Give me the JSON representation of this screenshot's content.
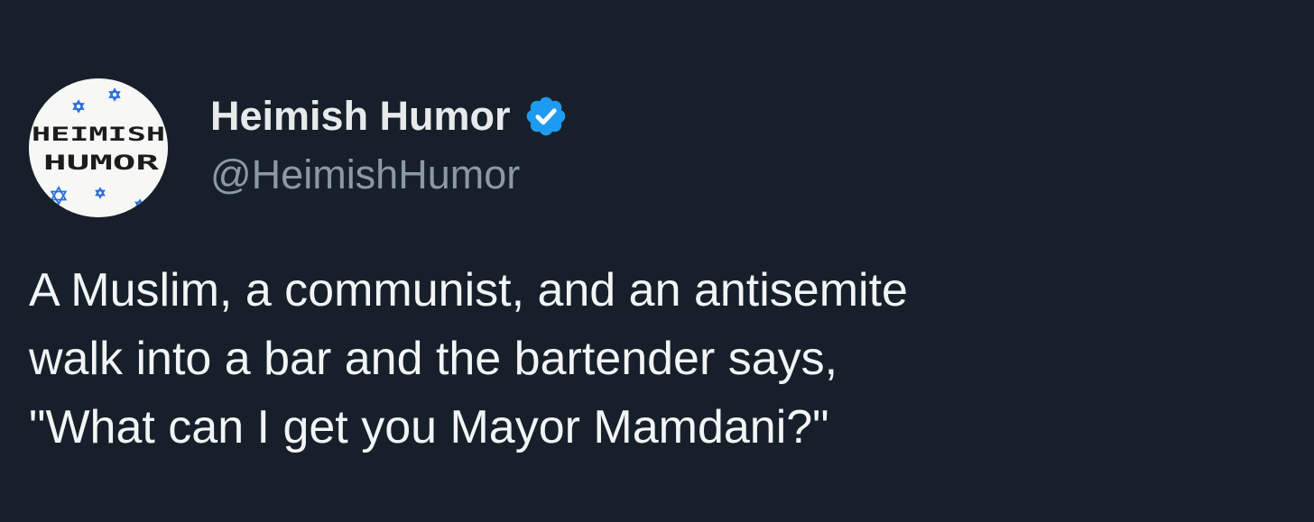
{
  "tweet": {
    "author": {
      "display_name": "Heimish Humor",
      "handle": "@HeimishHumor",
      "verified": true,
      "verified_icon": "verified-badge-icon",
      "avatar": {
        "logo_line_1": "HEIMISH",
        "logo_line_2": "HUMOR"
      }
    },
    "text": "A Muslim, a communist, and an antisemite\nwalk into a bar and the bartender says,\n\"What can I get you Mayor Mamdani?\""
  },
  "colors": {
    "background": "#17202a",
    "text_primary": "#e7e9ea",
    "text_secondary": "#8b98a5",
    "verified_blue": "#1d9bf0",
    "avatar_background": "#f7f7f5",
    "avatar_star": "#2a6fdb"
  }
}
